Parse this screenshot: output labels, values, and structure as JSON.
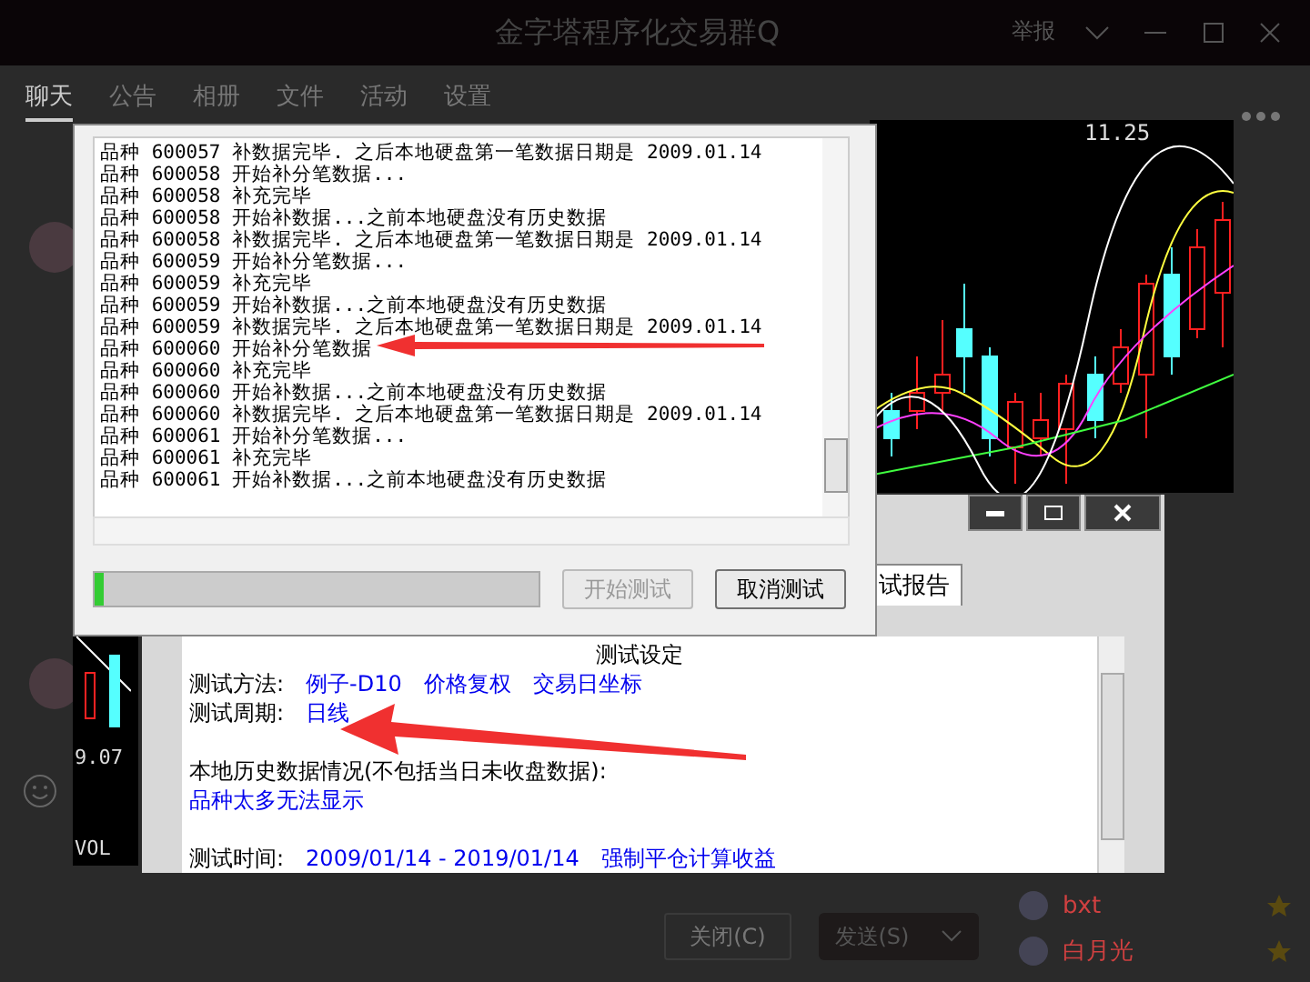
{
  "window": {
    "title": "金字塔程序化交易群Q",
    "report_link": "举报"
  },
  "tabs": [
    {
      "label": "聊天",
      "selected": true
    },
    {
      "label": "公告",
      "selected": false
    },
    {
      "label": "相册",
      "selected": false
    },
    {
      "label": "文件",
      "selected": false
    },
    {
      "label": "活动",
      "selected": false
    },
    {
      "label": "设置",
      "selected": false
    }
  ],
  "chart": {
    "price_label": "11.25",
    "left_price_label": "9.07",
    "left_volume_label": "VOL"
  },
  "log_dialog": {
    "lines": [
      "品种 600057 补数据完毕. 之后本地硬盘第一笔数据日期是 2009.01.14",
      "品种 600058 开始补分笔数据...",
      "品种 600058 补充完毕",
      "品种 600058 开始补数据...之前本地硬盘没有历史数据",
      "品种 600058 补数据完毕. 之后本地硬盘第一笔数据日期是 2009.01.14",
      "品种 600059 开始补分笔数据...",
      "品种 600059 补充完毕",
      "品种 600059 开始补数据...之前本地硬盘没有历史数据",
      "品种 600059 补数据完毕. 之后本地硬盘第一笔数据日期是 2009.01.14",
      "品种 600060 开始补分笔数据",
      "品种 600060 补充完毕",
      "品种 600060 开始补数据...之前本地硬盘没有历史数据",
      "品种 600060 补数据完毕. 之后本地硬盘第一笔数据日期是 2009.01.14",
      "品种 600061 开始补分笔数据...",
      "品种 600061 补充完毕",
      "品种 600061 开始补数据...之前本地硬盘没有历史数据"
    ],
    "progress": {
      "level": 0.02
    },
    "buttons": [
      {
        "label": "开始测试",
        "disabled": true
      },
      {
        "label": "取消测试",
        "disabled": false
      }
    ]
  },
  "report_window": {
    "tab": "试报告",
    "heading": "测试设定",
    "rows": [
      {
        "label": "测试方法:",
        "values": [
          "例子-D10",
          "价格复权",
          "交易日坐标"
        ]
      },
      {
        "label": "测试周期:",
        "values": [
          "日线"
        ]
      },
      {
        "label": "",
        "values": []
      },
      {
        "label": "本地历史数据情况(不包括当日未收盘数据):",
        "values": []
      },
      {
        "label": "",
        "values": [
          "品种太多无法显示"
        ]
      },
      {
        "label": "",
        "values": []
      },
      {
        "label": "测试时间:",
        "values": [
          "2009/01/14 - 2019/01/14",
          "强制平仓计算收益"
        ]
      }
    ]
  },
  "members": [
    {
      "name": "bxt"
    },
    {
      "name": "白月光"
    }
  ],
  "footer": {
    "close_button": "关闭(C)",
    "send_button": "发送(S)"
  }
}
